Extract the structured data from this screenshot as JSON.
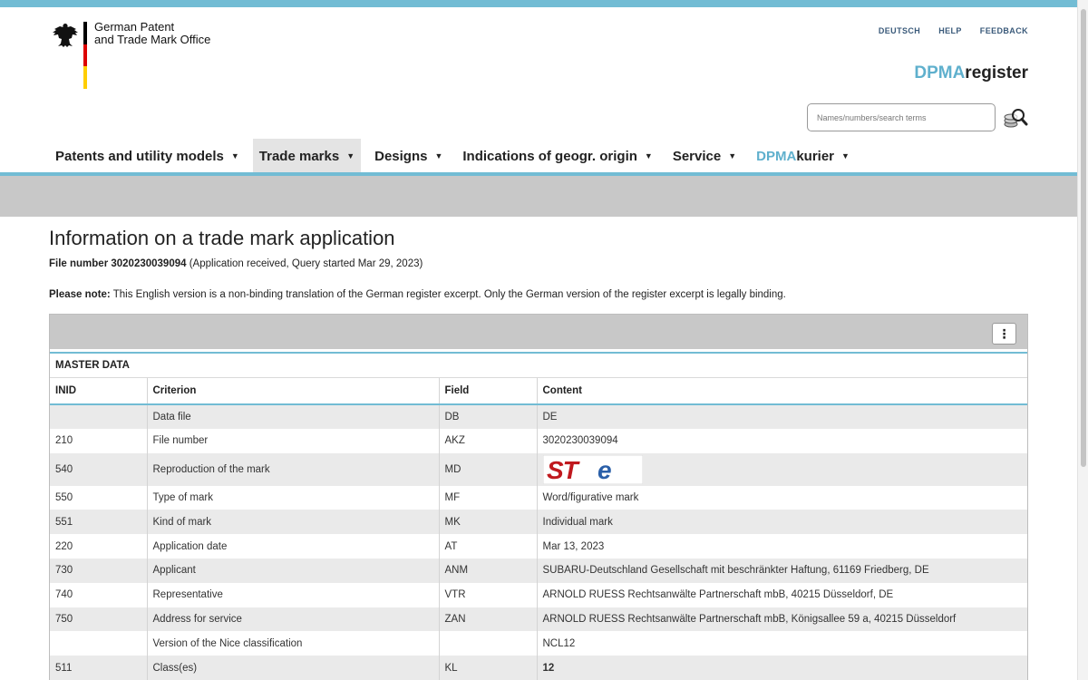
{
  "header": {
    "office_line1": "German Patent",
    "office_line2": "and Trade Mark Office",
    "meta_links": [
      "DEUTSCH",
      "HELP",
      "FEEDBACK"
    ],
    "brand_accent": "DPMA",
    "brand_rest": "register",
    "search_placeholder": "Names/numbers/search terms"
  },
  "nav": {
    "patents": "Patents and utility models",
    "trademarks": "Trade marks",
    "designs": "Designs",
    "geo": "Indications of geogr. origin",
    "service": "Service",
    "kurier_accent": "DPMA",
    "kurier_rest": "kurier"
  },
  "page": {
    "title": "Information on a trade mark application",
    "file_label": "File number 3020230039094",
    "file_status": " (Application received, Query started Mar 29, 2023)",
    "note_label": "Please note:",
    "note_text": " This English version is a non-binding translation of the German register excerpt. Only the German version of the register excerpt is legally binding."
  },
  "panel": {
    "menu_icon": "⋮",
    "section_title": "MASTER DATA",
    "columns": [
      "INID",
      "Criterion",
      "Field",
      "Content"
    ],
    "rows": [
      {
        "inid": "",
        "criterion": "Data file",
        "field": "DB",
        "content": "DE"
      },
      {
        "inid": "210",
        "criterion": "File number",
        "field": "AKZ",
        "content": "3020230039094"
      },
      {
        "inid": "540",
        "criterion": "Reproduction of the mark",
        "field": "MD",
        "content": ""
      },
      {
        "inid": "550",
        "criterion": "Type of mark",
        "field": "MF",
        "content": "Word/figurative mark"
      },
      {
        "inid": "551",
        "criterion": "Kind of mark",
        "field": "MK",
        "content": "Individual mark"
      },
      {
        "inid": "220",
        "criterion": "Application date",
        "field": "AT",
        "content": "Mar 13, 2023"
      },
      {
        "inid": "730",
        "criterion": "Applicant",
        "field": "ANM",
        "content": "SUBARU-Deutschland Gesellschaft mit beschränkter Haftung, 61169 Friedberg, DE"
      },
      {
        "inid": "740",
        "criterion": "Representative",
        "field": "VTR",
        "content": "ARNOLD RUESS Rechtsanwälte Partnerschaft mbB, 40215 Düsseldorf, DE"
      },
      {
        "inid": "750",
        "criterion": "Address for service",
        "field": "ZAN",
        "content": "ARNOLD RUESS Rechtsanwälte Partnerschaft mbB, Königsallee 59 a, 40215 Düsseldorf"
      },
      {
        "inid": "",
        "criterion": "Version of the Nice classification",
        "field": "",
        "content": "NCL12"
      },
      {
        "inid": "511",
        "criterion": "Class(es)",
        "field": "KL",
        "content": "12"
      }
    ],
    "mark_logo_text": "STe"
  },
  "colors": {
    "accent": "#72bcd4",
    "brand_blue": "#5fb0cd",
    "band_grey": "#c8c8c8",
    "mark_red": "#c0191e",
    "mark_blue": "#2a5fa8"
  }
}
